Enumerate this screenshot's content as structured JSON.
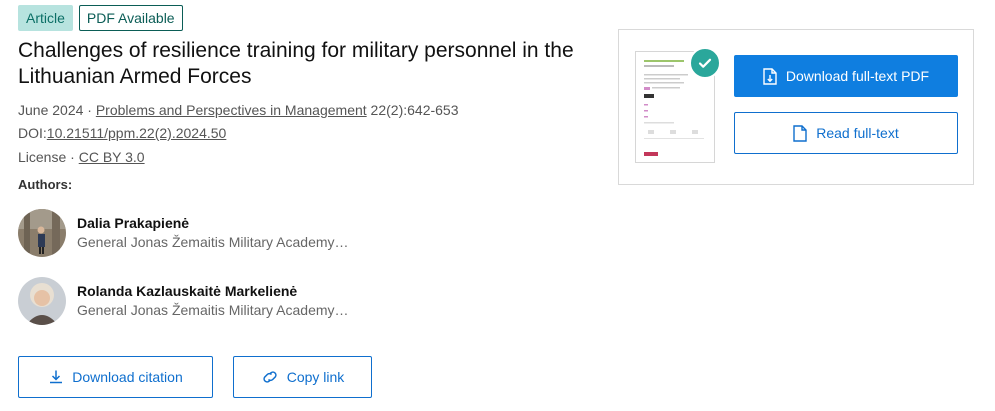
{
  "badges": {
    "article": "Article",
    "pdf": "PDF Available"
  },
  "title": "Challenges of resilience training for military personnel in the Lithuanian Armed Forces",
  "meta": {
    "date_prefix": "June 2024 · ",
    "journal": "Problems and Perspectives in Management",
    "issue": " 22(2):642-653",
    "doi_prefix": "DOI:",
    "doi": "10.21511/ppm.22(2).2024.50",
    "license_prefix": "License · ",
    "license": "CC BY 3.0"
  },
  "authors_label": "Authors:",
  "authors": [
    {
      "name": "Dalia Prakapienė",
      "affiliation": "General Jonas Žemaitis Military Academy…"
    },
    {
      "name": "Rolanda Kazlauskaitė Markelienė",
      "affiliation": "General Jonas Žemaitis Military Academy…"
    }
  ],
  "actions": {
    "download_citation": "Download citation",
    "copy_link": "Copy link"
  },
  "side": {
    "download_pdf": "Download full-text PDF",
    "read_full_text": "Read full-text"
  },
  "colors": {
    "primary": "#0f7ee0",
    "accent_teal": "#2aa79b",
    "badge_bg": "#b7e3df"
  },
  "icons": [
    "download-icon",
    "link-icon",
    "file-download-icon",
    "file-icon",
    "check-icon"
  ]
}
